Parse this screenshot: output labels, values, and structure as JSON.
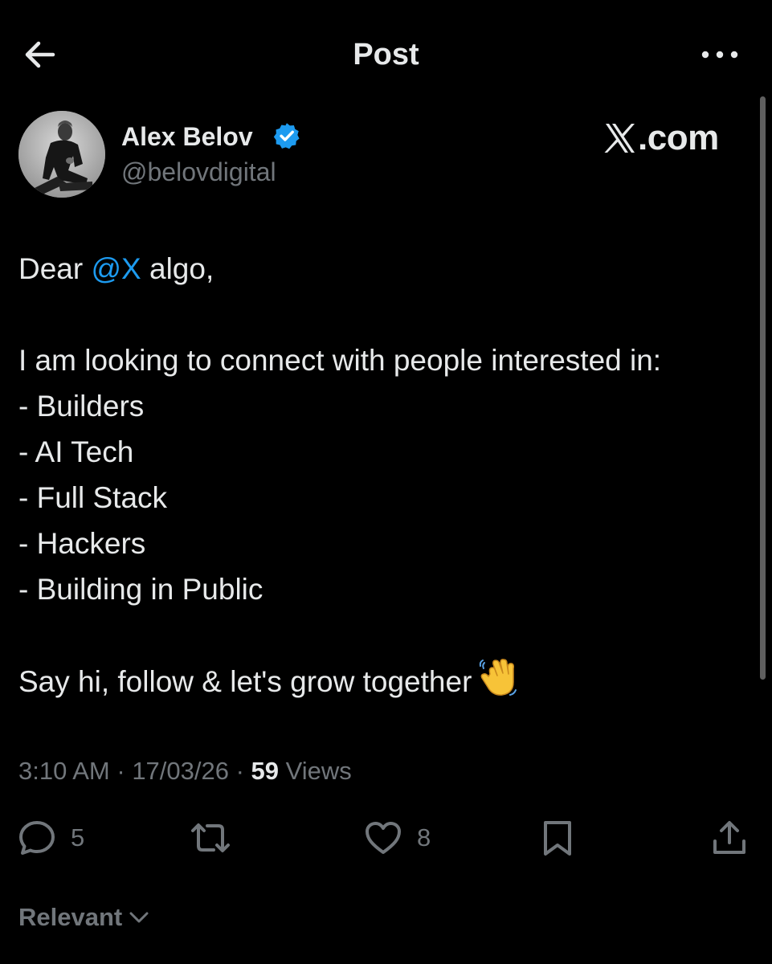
{
  "header": {
    "title": "Post",
    "back_icon": "arrow-left-icon",
    "more_icon": "more-horizontal-icon"
  },
  "author": {
    "name": "Alex Belov",
    "handle": "@belovdigital",
    "verified": true,
    "verified_color": "#1d9bf0"
  },
  "watermark": {
    "text": ".com",
    "logo": "x-logo-icon"
  },
  "post": {
    "greeting_prefix": "Dear ",
    "mention": "@X",
    "greeting_suffix": " algo,",
    "intro": "I am looking to connect with people interested in:",
    "list": [
      "- Builders",
      "- AI Tech",
      "- Full Stack",
      "- Hackers",
      "- Building in Public"
    ],
    "closing": "Say hi, follow & let's grow together",
    "closing_emoji": "waving-hand-icon"
  },
  "meta": {
    "time": "3:10 AM",
    "separator": " · ",
    "date": "17/03/26",
    "views_count": "59",
    "views_label": " Views"
  },
  "actions": {
    "replies": "5",
    "reposts": "",
    "likes": "8"
  },
  "sort": {
    "label": "Relevant"
  },
  "colors": {
    "background": "#000000",
    "text": "#e7e9ea",
    "secondary": "#71767b",
    "accent": "#1d9bf0"
  }
}
